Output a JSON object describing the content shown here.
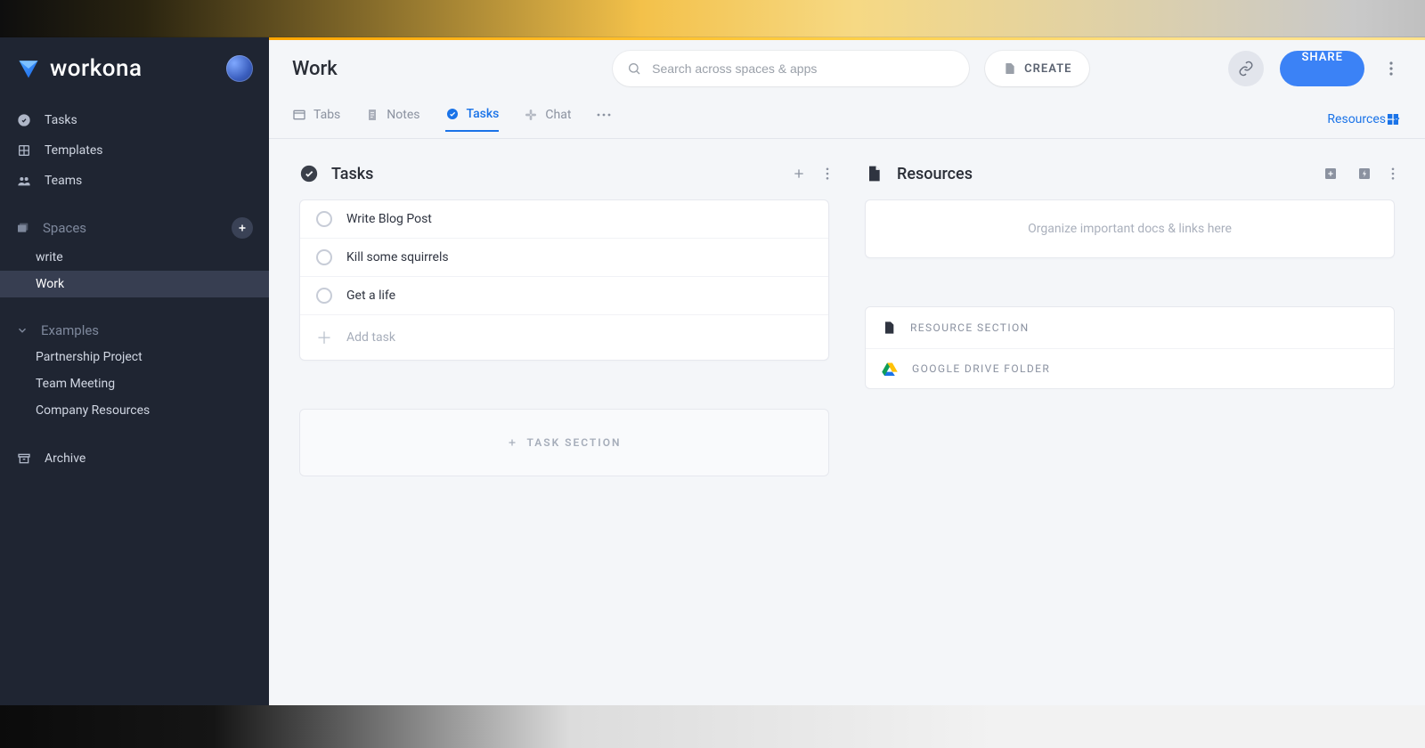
{
  "brand": {
    "name": "workona"
  },
  "sidebar": {
    "nav": [
      {
        "label": "Tasks"
      },
      {
        "label": "Templates"
      },
      {
        "label": "Teams"
      }
    ],
    "spaces_header": "Spaces",
    "spaces": [
      {
        "label": "write"
      },
      {
        "label": "Work"
      }
    ],
    "examples_header": "Examples",
    "examples": [
      {
        "label": "Partnership Project"
      },
      {
        "label": "Team Meeting"
      },
      {
        "label": "Company Resources"
      }
    ],
    "archive_label": "Archive"
  },
  "topbar": {
    "title": "Work",
    "search_placeholder": "Search across spaces & apps",
    "create_label": "CREATE",
    "share_label": "SHARE"
  },
  "tabs": {
    "tabs_label": "Tabs",
    "notes_label": "Notes",
    "tasks_label": "Tasks",
    "chat_label": "Chat",
    "resources_label": "Resources"
  },
  "tasks_panel": {
    "heading": "Tasks",
    "items": [
      {
        "title": "Write Blog Post"
      },
      {
        "title": "Kill some squirrels"
      },
      {
        "title": "Get a life"
      }
    ],
    "add_task_placeholder": "Add task",
    "task_section_label": "TASK SECTION"
  },
  "resources_panel": {
    "heading": "Resources",
    "placeholder_text": "Organize important docs & links here",
    "options": [
      {
        "label": "RESOURCE SECTION"
      },
      {
        "label": "GOOGLE DRIVE FOLDER"
      }
    ]
  }
}
